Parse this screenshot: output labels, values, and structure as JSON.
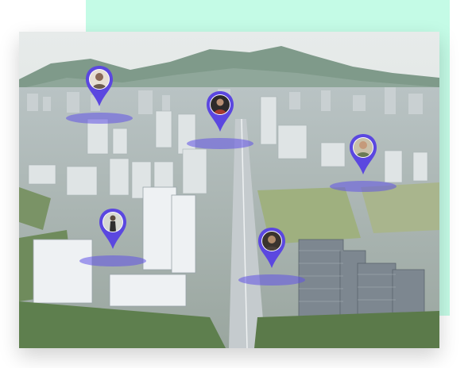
{
  "colors": {
    "mint_background": "#c4fbe6",
    "pin": "#5b47e0",
    "pin_halo": "rgba(96,82,230,0.55)"
  },
  "pins": [
    {
      "id": "pin-1",
      "icon": "map-pin-icon",
      "avatar": "user-avatar-1"
    },
    {
      "id": "pin-2",
      "icon": "map-pin-icon",
      "avatar": "user-avatar-2"
    },
    {
      "id": "pin-3",
      "icon": "map-pin-icon",
      "avatar": "user-avatar-3"
    },
    {
      "id": "pin-4",
      "icon": "map-pin-icon",
      "avatar": "user-avatar-4"
    },
    {
      "id": "pin-5",
      "icon": "map-pin-icon",
      "avatar": "user-avatar-5"
    }
  ]
}
